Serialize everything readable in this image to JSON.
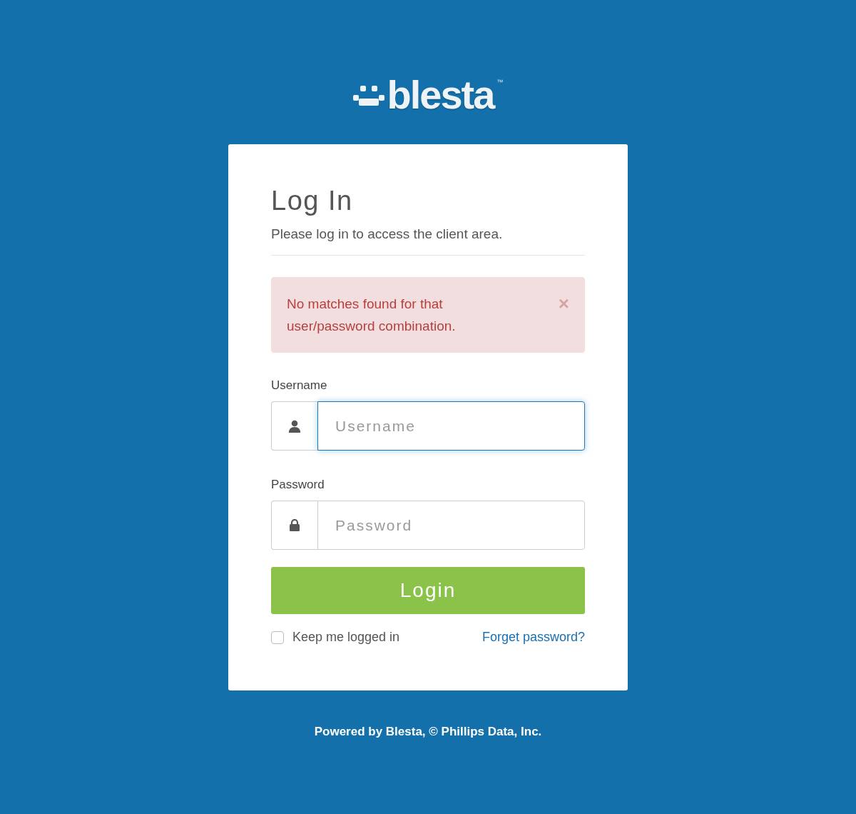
{
  "logo": {
    "name": "blesta",
    "trademark": "™"
  },
  "login": {
    "title": "Log In",
    "subtitle": "Please log in to access the client area.",
    "alert": {
      "message": "No matches found for that user/password combination.",
      "close": "×"
    },
    "fields": [
      {
        "label": "Username",
        "placeholder": "Username",
        "kind": "user",
        "focused": true
      },
      {
        "label": "Password",
        "placeholder": "Password",
        "kind": "lock",
        "focused": false
      }
    ],
    "submit": "Login",
    "remember": {
      "label": "Keep me logged in",
      "checked": false
    },
    "forgot": "Forget password?"
  },
  "footer": "Powered by Blesta, © Phillips Data, Inc."
}
